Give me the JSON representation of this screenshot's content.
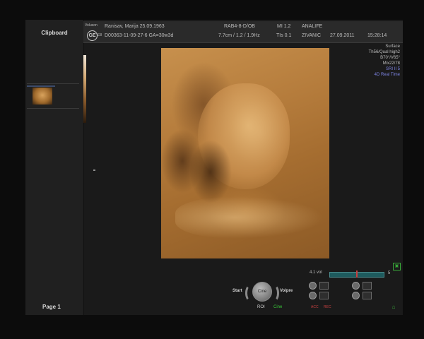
{
  "clipboard": {
    "title": "Clipboard",
    "page_label": "Page 1"
  },
  "logo": {
    "brand": "Voluson",
    "mark": "GE",
    "sub": "E8"
  },
  "header": {
    "patient": "Ranisav, Marija  25.09.1963",
    "exam_id": "D00363-11-09-27-6  GA=30w3d",
    "probe": "RAB4-8-D/OB",
    "params": "7.7cm / 1.2 / 1.9Hz",
    "mi": "MI  1.2",
    "tis": "TIs  0.1",
    "institution": "ANALIFE",
    "operator": "ZIVANIC",
    "date": "27.09.2011",
    "time": "15:28:14"
  },
  "info_panel": {
    "lines": [
      "Surface",
      "Th56/Qual high2",
      "B70°/V65°",
      "Mix22/78"
    ],
    "blue_lines": [
      "SRI II 5",
      "4D Real Time"
    ]
  },
  "velocity": {
    "label": "4.1 vol",
    "value": "5",
    "level": 0.5
  },
  "controls": {
    "start_label": "Start",
    "cine_label": "Cine",
    "volpre_label": "Volpre",
    "roi_label": "ROI",
    "cine_green": "Cine",
    "acq_a": "ACC",
    "acq_b": "REC",
    "small_1": "±",
    "small_2": "±"
  },
  "colors": {
    "render": "#b57c3c",
    "accent_blue": "#7f86e6",
    "accent_green": "#38a838",
    "accent_red": "#c84040"
  }
}
